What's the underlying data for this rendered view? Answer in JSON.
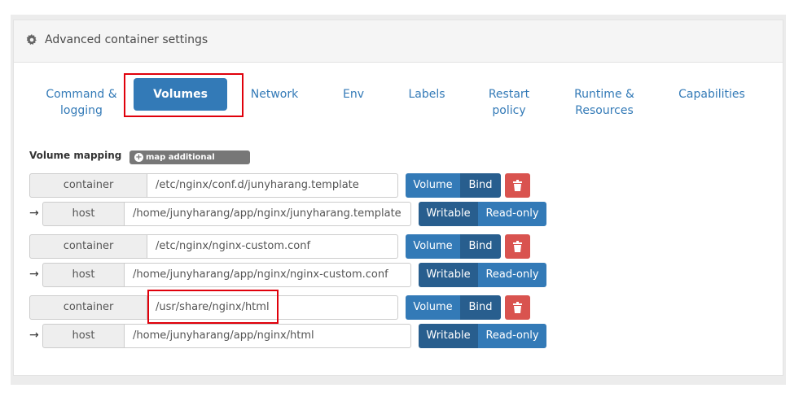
{
  "panel": {
    "title": "Advanced container settings",
    "icon": "gear-icon"
  },
  "tabs": [
    {
      "label": "Command & logging"
    },
    {
      "label": "Volumes",
      "active": true
    },
    {
      "label": "Network"
    },
    {
      "label": "Env"
    },
    {
      "label": "Labels"
    },
    {
      "label": "Restart policy"
    },
    {
      "label": "Runtime & Resources"
    },
    {
      "label": "Capabilities"
    }
  ],
  "volumes": {
    "section_label": "Volume mapping",
    "add_label": "map additional volume",
    "rows": [
      {
        "container_label": "container",
        "container_path": "/etc/nginx/conf.d/junyharang.template",
        "host_label": "host",
        "host_path": "/home/junyharang/app/nginx/junyharang.template",
        "type_options": [
          "Volume",
          "Bind"
        ],
        "type_selected": "Bind",
        "mode_options": [
          "Writable",
          "Read-only"
        ],
        "mode_selected": "Writable"
      },
      {
        "container_label": "container",
        "container_path": "/etc/nginx/nginx-custom.conf",
        "host_label": "host",
        "host_path": "/home/junyharang/app/nginx/nginx-custom.conf",
        "type_options": [
          "Volume",
          "Bind"
        ],
        "type_selected": "Bind",
        "mode_options": [
          "Writable",
          "Read-only"
        ],
        "mode_selected": "Writable"
      },
      {
        "container_label": "container",
        "container_path": "/usr/share/nginx/html",
        "host_label": "host",
        "host_path": "/home/junyharang/app/nginx/html",
        "type_options": [
          "Volume",
          "Bind"
        ],
        "type_selected": "Bind",
        "mode_options": [
          "Writable",
          "Read-only"
        ],
        "mode_selected": "Writable"
      }
    ]
  },
  "colors": {
    "primary": "#337ab7",
    "primary_active": "#285e8e",
    "danger": "#d9534f",
    "highlight": "#e0000b"
  }
}
